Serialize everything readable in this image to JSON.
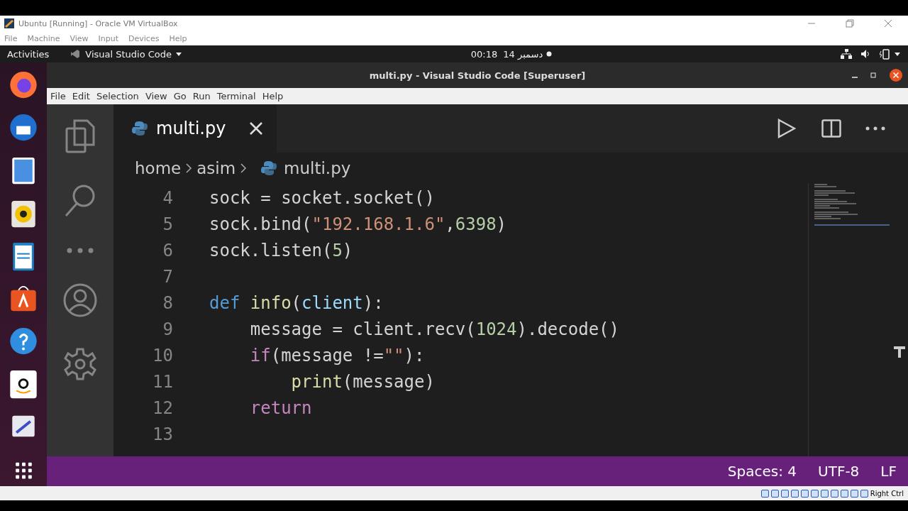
{
  "host_window": {
    "title": "Ubuntu [Running] - Oracle VM VirtualBox",
    "menu": [
      "File",
      "Machine",
      "View",
      "Input",
      "Devices",
      "Help"
    ]
  },
  "top_bar": {
    "activities": "Activities",
    "app": "Visual Studio Code",
    "time": "00:18",
    "date": "14 دسمبر"
  },
  "vscode": {
    "title": "multi.py - Visual Studio Code [Superuser]",
    "menu": [
      "File",
      "Edit",
      "Selection",
      "View",
      "Go",
      "Run",
      "Terminal",
      "Help"
    ],
    "tabs": [
      {
        "label": "multi.py",
        "selected": true
      }
    ],
    "breadcrumb": [
      "home",
      "asim",
      "multi.py"
    ],
    "lines": [
      {
        "number": "4",
        "tokens": [
          {
            "text": "sock = socket.socket()",
            "kind": "plain"
          }
        ]
      },
      {
        "number": "5",
        "tokens": [
          {
            "text": "sock.bind(",
            "kind": "plain"
          },
          {
            "text": "\"192.168.1.6\"",
            "kind": "string"
          },
          {
            "text": ",",
            "kind": "plain"
          },
          {
            "text": "6398",
            "kind": "number"
          },
          {
            "text": ")",
            "kind": "plain"
          }
        ]
      },
      {
        "number": "6",
        "tokens": [
          {
            "text": "sock.listen(",
            "kind": "plain"
          },
          {
            "text": "5",
            "kind": "number"
          },
          {
            "text": ")",
            "kind": "plain"
          }
        ]
      },
      {
        "number": "7"
      },
      {
        "number": "8",
        "tokens": [
          {
            "text": "def ",
            "kind": "keyword"
          },
          {
            "text": "info",
            "kind": "function"
          },
          {
            "text": "(",
            "kind": "plain"
          },
          {
            "text": "client",
            "kind": "variable"
          },
          {
            "text": "):",
            "kind": "plain"
          }
        ]
      },
      {
        "number": "9",
        "tokens": [
          {
            "text": "    message = client.recv(",
            "kind": "plain"
          },
          {
            "text": "1024",
            "kind": "number"
          },
          {
            "text": ").decode()",
            "kind": "plain"
          }
        ]
      },
      {
        "number": "10",
        "tokens": [
          {
            "text": "    if",
            "kind": "control"
          },
          {
            "text": "(message !=",
            "kind": "plain"
          },
          {
            "text": "\"\"",
            "kind": "string"
          },
          {
            "text": "):",
            "kind": "plain"
          }
        ]
      },
      {
        "number": "11",
        "tokens": [
          {
            "text": "        print",
            "kind": "function"
          },
          {
            "text": "(message)",
            "kind": "plain"
          }
        ]
      },
      {
        "number": "12",
        "tokens": [
          {
            "text": "    return",
            "kind": "control"
          }
        ]
      },
      {
        "number": "13"
      }
    ],
    "status": [
      "Spaces: 4",
      "UTF-8",
      "LF"
    ]
  },
  "host_status": {
    "host_key": "Right Ctrl"
  }
}
